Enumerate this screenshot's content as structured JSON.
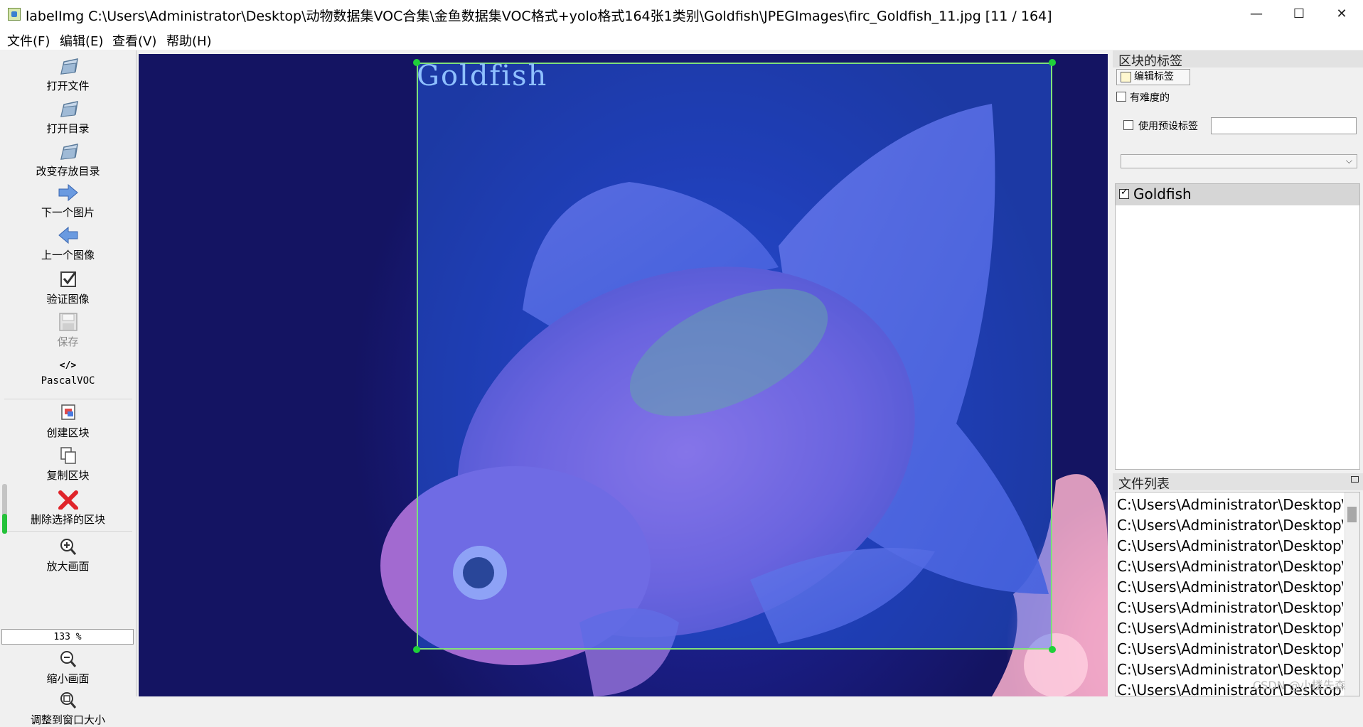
{
  "window": {
    "title": "labelImg C:\\Users\\Administrator\\Desktop\\动物数据集VOC合集\\金鱼数据集VOC格式+yolo格式164张1类别\\Goldfish\\JPEGImages\\firc_Goldfish_11.jpg [11 / 164]",
    "minimize": "—",
    "maximize": "☐",
    "close": "✕"
  },
  "menu": {
    "items": [
      {
        "label": "文件(F)"
      },
      {
        "label": "编辑(E)"
      },
      {
        "label": "查看(V)"
      },
      {
        "label": "帮助(H)"
      }
    ]
  },
  "toolbar": {
    "open_file": "打开文件",
    "open_dir": "打开目录",
    "change_save_dir": "改变存放目录",
    "next_image": "下一个图片",
    "prev_image": "上一个图像",
    "verify_image": "验证图像",
    "save": "保存",
    "format_icon": "</>",
    "format": "PascalVOC",
    "create_box": "创建区块",
    "duplicate_box": "复制区块",
    "delete_box": "删除选择的区块",
    "zoom_in": "放大画面",
    "zoom_level": "133 %",
    "zoom_out": "缩小画面",
    "fit_window": "调整到窗口大小"
  },
  "canvas": {
    "box_label": "Goldfish"
  },
  "box_labels_dock": {
    "title": "区块的标签",
    "edit_label_button": "编辑标签",
    "difficult_label": "有难度的",
    "use_default_label": "使用预设标签",
    "default_label_value": "",
    "labels": [
      {
        "text": "Goldfish",
        "checked": true
      }
    ]
  },
  "file_list_dock": {
    "title": "文件列表",
    "files": [
      "C:\\Users\\Administrator\\Desktop\\动",
      "C:\\Users\\Administrator\\Desktop\\动",
      "C:\\Users\\Administrator\\Desktop\\动",
      "C:\\Users\\Administrator\\Desktop\\动",
      "C:\\Users\\Administrator\\Desktop\\动",
      "C:\\Users\\Administrator\\Desktop\\动",
      "C:\\Users\\Administrator\\Desktop\\动",
      "C:\\Users\\Administrator\\Desktop\\动",
      "C:\\Users\\Administrator\\Desktop\\动",
      "C:\\Users\\Administrator\\Desktop\\动"
    ]
  },
  "watermark": "CSDN @小楼先森"
}
